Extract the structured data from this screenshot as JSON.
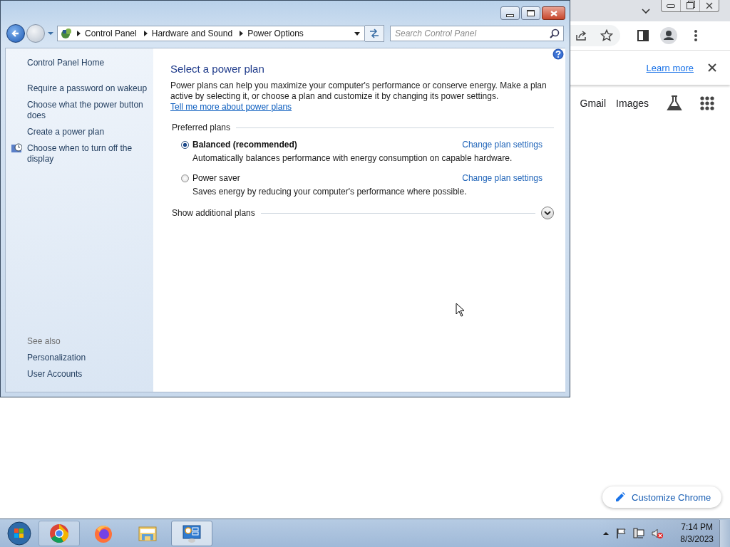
{
  "browser": {
    "infobar_link": "Learn more",
    "header_links": [
      "Gmail",
      "Images"
    ],
    "customize_button": "Customize Chrome"
  },
  "control_panel": {
    "breadcrumb": [
      "Control Panel",
      "Hardware and Sound",
      "Power Options"
    ],
    "search": {
      "placeholder": "Search Control Panel"
    },
    "sidebar": {
      "home": "Control Panel Home",
      "links": [
        {
          "label": "Require a password on wakeup",
          "icon": false
        },
        {
          "label": "Choose what the power button does",
          "icon": false
        },
        {
          "label": "Create a power plan",
          "icon": false
        },
        {
          "label": "Choose when to turn off the display",
          "icon": true
        }
      ],
      "see_also": {
        "heading": "See also",
        "links": [
          "Personalization",
          "User Accounts"
        ]
      }
    },
    "main": {
      "title": "Select a power plan",
      "intro": "Power plans can help you maximize your computer's performance or conserve energy. Make a plan active by selecting it, or choose a plan and customize it by changing its power settings.",
      "intro_link": "Tell me more about power plans",
      "section": "Preferred plans",
      "plans": [
        {
          "name": "Balanced (recommended)",
          "description": "Automatically balances performance with energy consumption on capable hardware.",
          "link": "Change plan settings",
          "selected": true
        },
        {
          "name": "Power saver",
          "description": "Saves energy by reducing your computer's performance where possible.",
          "link": "Change plan settings",
          "selected": false
        }
      ],
      "additional": "Show additional plans"
    }
  },
  "taskbar": {
    "apps": [
      {
        "kind": "chrome",
        "selected": false
      },
      {
        "kind": "firefox",
        "selected": false
      },
      {
        "kind": "explorer",
        "selected": false
      },
      {
        "kind": "control_panel",
        "selected": true
      }
    ],
    "clock": {
      "time": "7:14 PM",
      "date": "8/3/2023"
    }
  }
}
